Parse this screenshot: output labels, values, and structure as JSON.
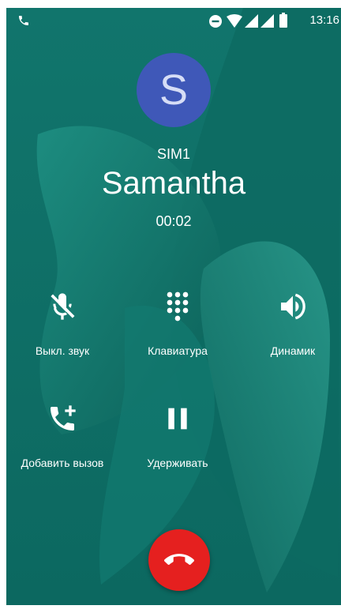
{
  "status_bar": {
    "time": "13:16",
    "icons": [
      "phone-call-icon",
      "do-not-disturb-icon",
      "wifi-icon",
      "signal-icon",
      "signal-icon",
      "battery-icon"
    ]
  },
  "call": {
    "avatar_letter": "S",
    "sim": "SIM1",
    "contact_name": "Samantha",
    "timer": "00:02"
  },
  "actions": {
    "mute": {
      "label": "Выкл. звук",
      "icon": "mic-off-icon"
    },
    "keypad": {
      "label": "Клавиатура",
      "icon": "dialpad-icon"
    },
    "speaker": {
      "label": "Динамик",
      "icon": "speaker-icon"
    },
    "add_call": {
      "label": "Добавить вызов",
      "icon": "add-call-icon"
    },
    "hold": {
      "label": "Удерживать",
      "icon": "pause-icon"
    }
  },
  "end_call": {
    "icon": "end-call-icon"
  },
  "colors": {
    "background": "#0f6e66",
    "avatar": "#3f58b8",
    "end_call": "#e5201f"
  }
}
